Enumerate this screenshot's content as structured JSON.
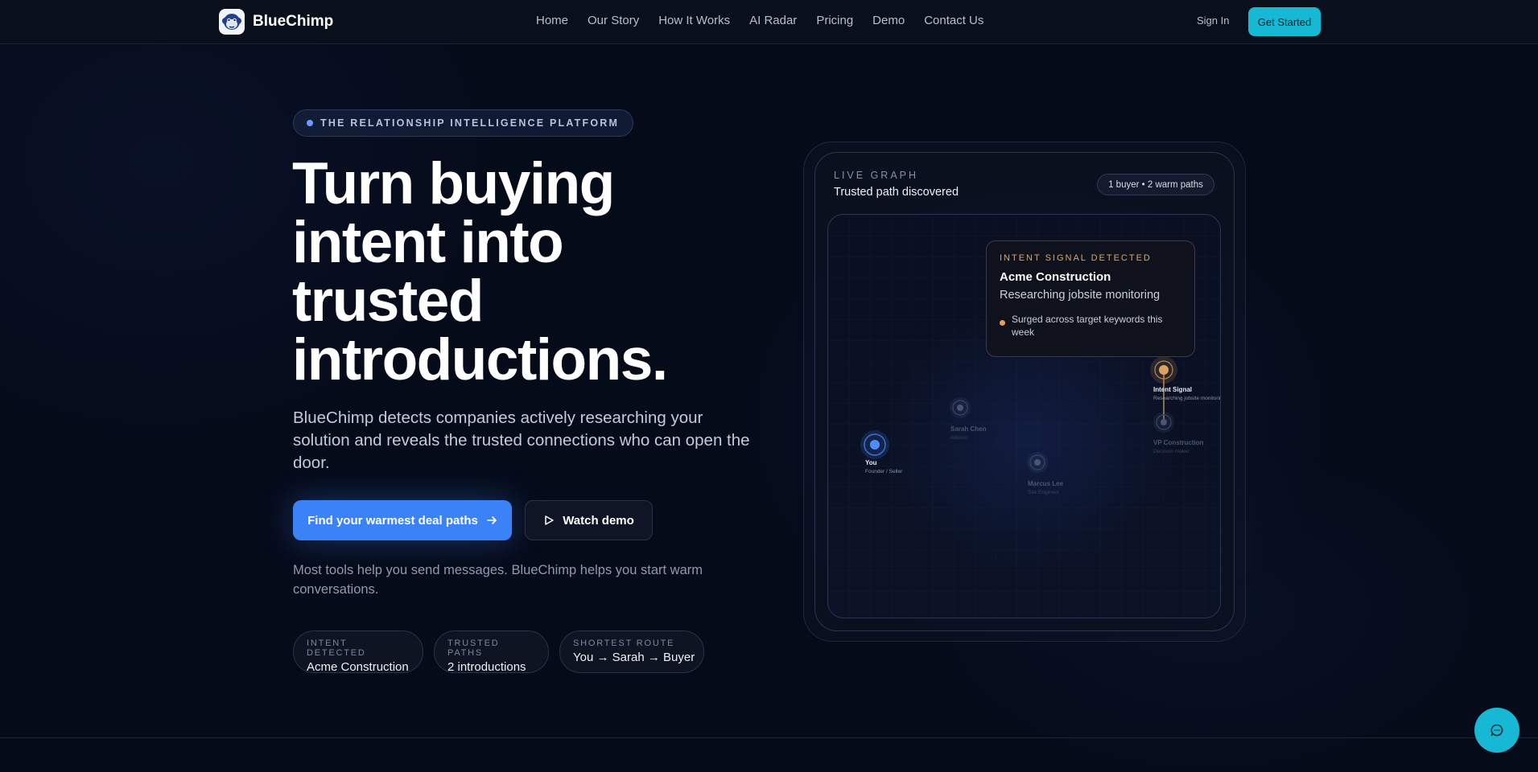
{
  "brand": {
    "name": "BlueChimp",
    "logo_icon": "chimp-face-icon"
  },
  "nav": {
    "links": [
      "Home",
      "Our Story",
      "How It Works",
      "AI Radar",
      "Pricing",
      "Demo",
      "Contact Us"
    ],
    "sign_in": "Sign In",
    "cta": "Get Started"
  },
  "hero": {
    "eyebrow": "THE RELATIONSHIP INTELLIGENCE PLATFORM",
    "headline_lines": [
      "Turn buying",
      "intent into",
      "trusted",
      "introductions."
    ],
    "subhead": "BlueChimp detects companies actively researching your solution and reveals the trusted connections who can open the door.",
    "primary_button": "Find your warmest deal paths",
    "secondary_button": "Watch demo",
    "tagline": "Most tools help you send messages. BlueChimp helps you start warm conversations.",
    "chips": [
      {
        "label": "INTENT DETECTED",
        "value": "Acme Construction"
      },
      {
        "label": "TRUSTED PATHS",
        "value": "2 introductions"
      },
      {
        "label": "SHORTEST ROUTE",
        "value": "You → Sarah → Buyer"
      }
    ]
  },
  "graph_card": {
    "label": "LIVE GRAPH",
    "title": "Trusted path discovered",
    "pill": "1 buyer • 2 warm paths",
    "intent": {
      "label": "INTENT SIGNAL DETECTED",
      "company": "Acme Construction",
      "description": "Researching jobsite monitoring",
      "note": "Surged across target keywords this week"
    },
    "nodes": [
      {
        "name": "You",
        "role": "Founder / Seller"
      },
      {
        "name": "Sarah Chen",
        "role": "Advisor"
      },
      {
        "name": "Marcus Lee",
        "role": "Site Engineer"
      },
      {
        "name": "Intent Signal",
        "role": "Researching jobsite monitoring"
      },
      {
        "name": "VP Construction",
        "role": "Decision maker"
      }
    ]
  },
  "colors": {
    "accent": "#3b82f6",
    "cta": "#17b8d3",
    "intent": "#e0a060",
    "background": "#060b1a"
  },
  "chat": {
    "icon": "chat-bubble-icon"
  }
}
